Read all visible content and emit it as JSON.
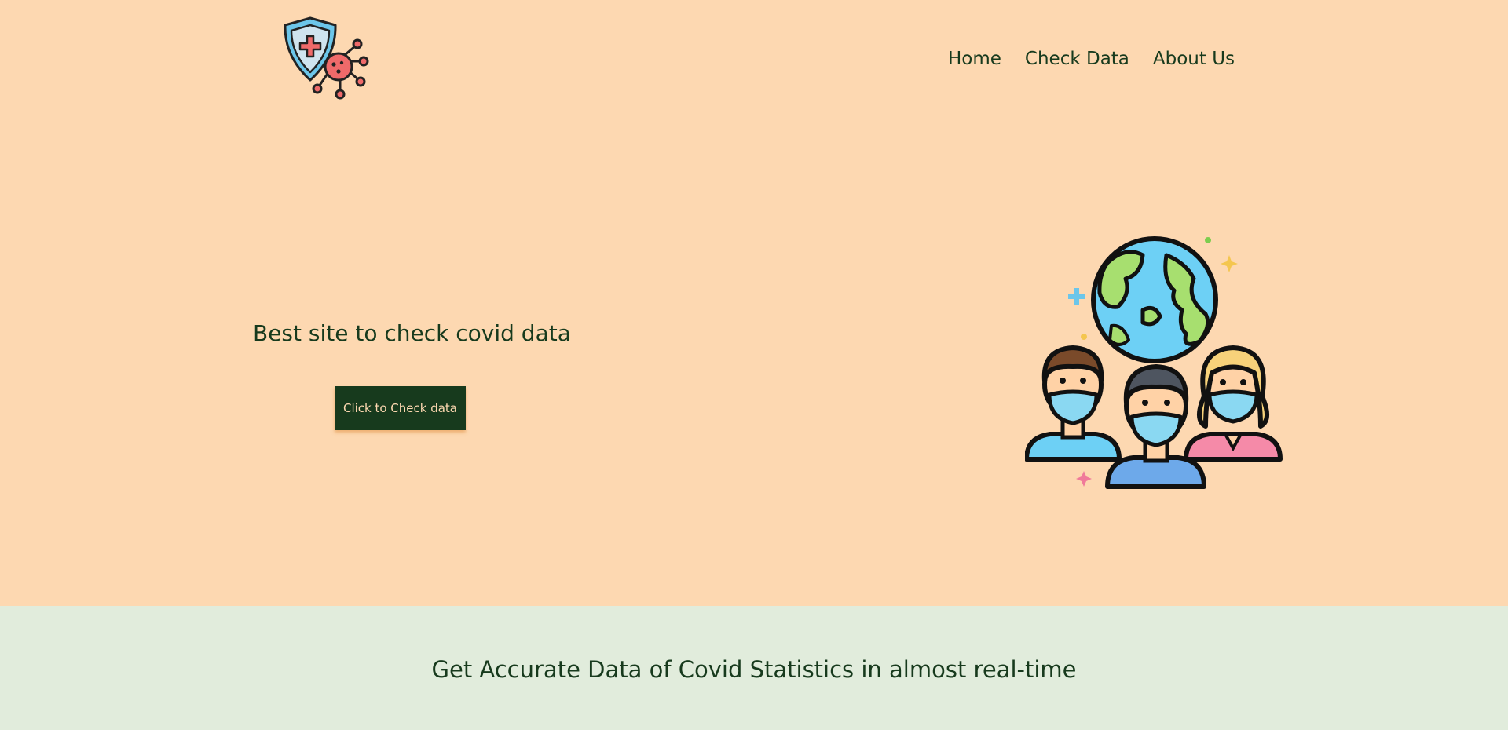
{
  "nav": {
    "items": [
      {
        "label": "Home"
      },
      {
        "label": "Check Data"
      },
      {
        "label": "About Us"
      }
    ]
  },
  "hero": {
    "tagline": "Best site to check covid data",
    "cta_label": "Click to Check data"
  },
  "footer": {
    "text": "Get Accurate Data of Covid Statistics in almost real-time"
  },
  "icons": {
    "logo": "shield-virus-icon",
    "illustration": "masked-people-globe-icon"
  },
  "colors": {
    "hero_bg": "#fdd8b1",
    "footer_bg": "#e1ecdc",
    "dark_green": "#173a1d",
    "button_text": "#fdd8b1"
  }
}
